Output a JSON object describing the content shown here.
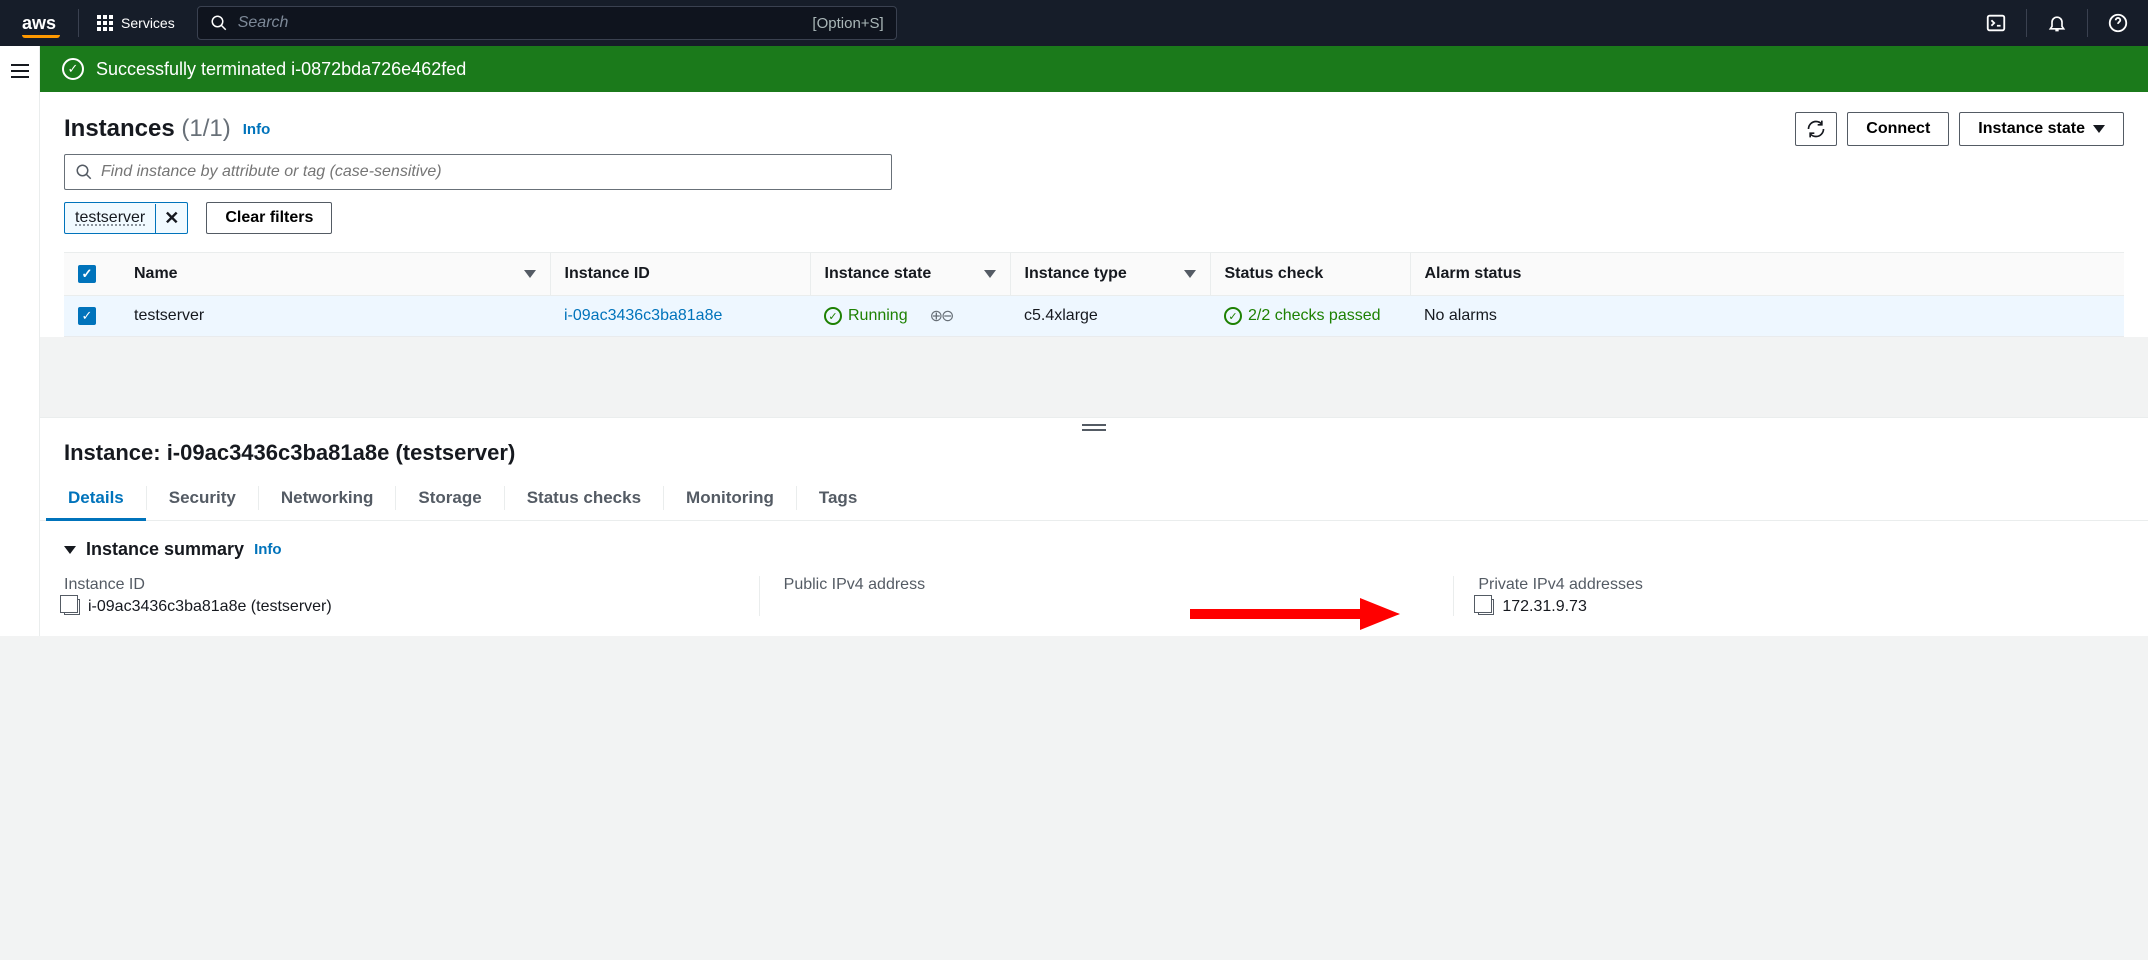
{
  "topnav": {
    "logo_text": "aws",
    "services_label": "Services",
    "search_placeholder": "Search",
    "search_kbd": "[Option+S]"
  },
  "banner": {
    "message": "Successfully terminated i-0872bda726e462fed"
  },
  "instances": {
    "title": "Instances",
    "count": "(1/1)",
    "info": "Info",
    "refresh": "Refresh",
    "connect": "Connect",
    "state_btn": "Instance state",
    "search_placeholder": "Find instance by attribute or tag (case-sensitive)",
    "filter_chip": "testserver",
    "clear_filters": "Clear filters",
    "columns": {
      "name": "Name",
      "id": "Instance ID",
      "state": "Instance state",
      "type": "Instance type",
      "status": "Status check",
      "alarm": "Alarm status"
    },
    "row": {
      "name": "testserver",
      "id": "i-09ac3436c3ba81a8e",
      "state": "Running",
      "type": "c5.4xlarge",
      "status": "2/2 checks passed",
      "alarm": "No alarms"
    }
  },
  "detail": {
    "title": "Instance: i-09ac3436c3ba81a8e (testserver)",
    "tabs": {
      "details": "Details",
      "security": "Security",
      "networking": "Networking",
      "storage": "Storage",
      "status": "Status checks",
      "monitoring": "Monitoring",
      "tags": "Tags"
    },
    "summary_title": "Instance summary",
    "summary_info": "Info",
    "fields": {
      "instance_id_label": "Instance ID",
      "instance_id_value": "i-09ac3436c3ba81a8e (testserver)",
      "public_ip_label": "Public IPv4 address",
      "private_ip_label": "Private IPv4 addresses",
      "private_ip_value": "172.31.9.73"
    }
  }
}
